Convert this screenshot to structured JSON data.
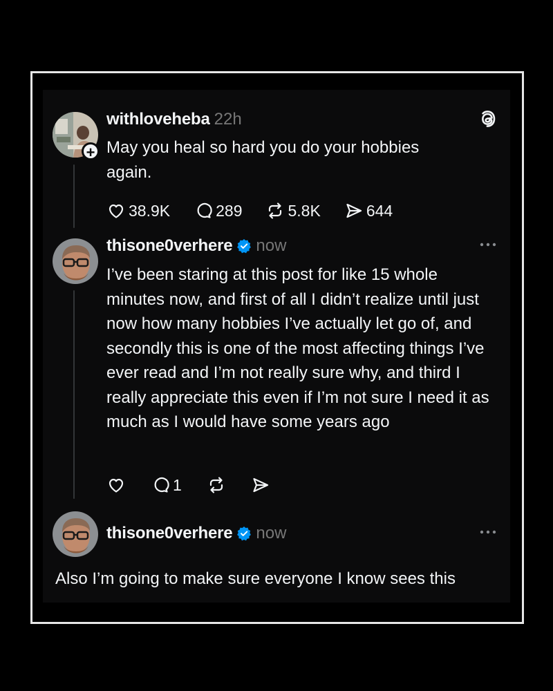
{
  "posts": [
    {
      "username": "withloveheba",
      "time": "22h",
      "text": "May you heal so hard you do your hobbies again.",
      "stats": {
        "likes": "38.9K",
        "replies": "289",
        "reposts": "5.8K",
        "shares": "644"
      }
    },
    {
      "username": "thisone0verhere",
      "time": "now",
      "text": "I’ve been staring at this post for like 15 whole minutes now, and first of all I didn’t realize until just now how many hobbies I’ve actually let go of, and secondly this is one of the most affecting things I’ve ever read and I’m not really sure why, and third I really appreciate this even if I’m not sure I need it as much as I would have some years ago",
      "stats": {
        "replies": "1"
      }
    },
    {
      "username": "thisone0verhere",
      "time": "now",
      "text": "Also I’m going to make sure everyone I know sees this"
    }
  ],
  "colors": {
    "background": "#000000",
    "card": "#0b0b0c",
    "text": "#f3f5f7",
    "muted": "#777777",
    "verified": "#0095f6",
    "frame": "#e6e6e6"
  }
}
